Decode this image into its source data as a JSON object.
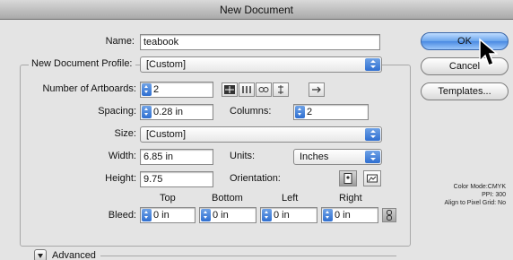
{
  "window": {
    "title": "New Document"
  },
  "form": {
    "name_label": "Name:",
    "name_value": "teabook",
    "profile_label": "New Document Profile:",
    "profile_value": "[Custom]",
    "artboards_label": "Number of Artboards:",
    "artboards_value": "2",
    "spacing_label": "Spacing:",
    "spacing_value": "0.28 in",
    "columns_label": "Columns:",
    "columns_value": "2",
    "size_label": "Size:",
    "size_value": "[Custom]",
    "width_label": "Width:",
    "width_value": "6.85 in",
    "units_label": "Units:",
    "units_value": "Inches",
    "height_label": "Height:",
    "height_value": "9.75",
    "orientation_label": "Orientation:",
    "bleed_label": "Bleed:",
    "bleed_headers": {
      "top": "Top",
      "bottom": "Bottom",
      "left": "Left",
      "right": "Right"
    },
    "bleed_values": {
      "top": "0 in",
      "bottom": "0 in",
      "left": "0 in",
      "right": "0 in"
    },
    "advanced_label": "Advanced"
  },
  "buttons": {
    "ok": "OK",
    "cancel": "Cancel",
    "templates": "Templates..."
  },
  "info": {
    "color_mode": "Color Mode:CMYK",
    "ppi": "PPI: 300",
    "align": "Align to Pixel Grid: No"
  },
  "icons": {
    "grid_by_row": "grid-by-row-icon",
    "grid_by_column": "grid-by-column-icon",
    "arrange_by_row": "arrange-by-row-icon",
    "arrange_by_column": "arrange-by-column-icon",
    "right_to_left": "right-to-left-icon",
    "portrait": "portrait-icon",
    "landscape": "landscape-icon",
    "link": "link-icon",
    "cursor": "cursor-icon"
  }
}
